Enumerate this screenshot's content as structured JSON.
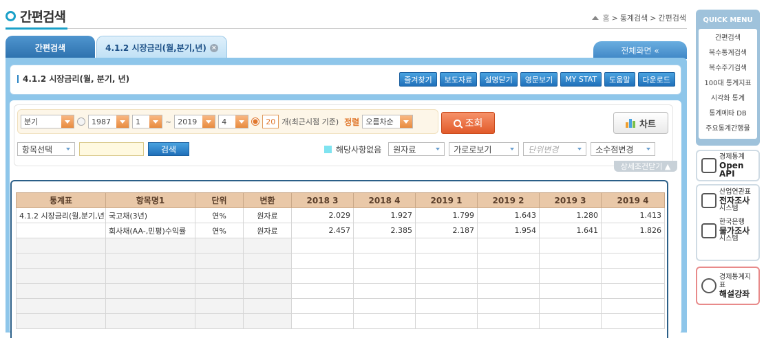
{
  "header": {
    "title": "간편검색",
    "breadcrumb": [
      "홈",
      "통계검색",
      "간편검색"
    ]
  },
  "tabs": [
    {
      "label": "간편검색",
      "active": false
    },
    {
      "label": "4.1.2 시장금리(월,분기,년)",
      "active": true,
      "closable": true
    }
  ],
  "fullscreen_label": "전체화면 «",
  "subheader": {
    "title": "4.1.2 시장금리(월, 분기, 년)",
    "buttons": [
      "즐겨찾기",
      "보도자료",
      "설명닫기",
      "영문보기",
      "MY STAT",
      "도움말",
      "다운로드"
    ]
  },
  "search": {
    "period": "분기",
    "from_year": "1987",
    "from_q": "1",
    "tilde": "~",
    "to_year": "2019",
    "to_q": "4",
    "recent_count": "20",
    "count_label": "개(최근시점 기준)",
    "sort_label": "정렬",
    "sort_value": "오름차순",
    "query_label": "조회",
    "chart_label": "차트",
    "item_select": "항목선택",
    "search_label": "검색",
    "legend": "해당사항없음",
    "data_type": "원자료",
    "view_mode": "가로로보기",
    "unit_change": "단위변경",
    "decimal_change": "소수점변경",
    "collapse_label": "상세조건닫기 ▲"
  },
  "table": {
    "headers": [
      "통계표",
      "항목명1",
      "단위",
      "변환",
      "2018 3",
      "2018 4",
      "2019 1",
      "2019 2",
      "2019 3",
      "2019 4"
    ],
    "rows": [
      {
        "stat": "4.1.2 시장금리(월,분기,년)",
        "item": "국고채(3년)",
        "unit": "연%",
        "conv": "원자료",
        "values": [
          "2.029",
          "1.927",
          "1.799",
          "1.643",
          "1.280",
          "1.413"
        ]
      },
      {
        "stat": "",
        "item": "회사채(AA-,민평)수익률",
        "unit": "연%",
        "conv": "원자료",
        "values": [
          "2.457",
          "2.385",
          "2.187",
          "1.954",
          "1.641",
          "1.826"
        ]
      }
    ]
  },
  "sidebar": {
    "quick_menu_title": "QUICK MENU",
    "quick_menu": [
      "간편검색",
      "복수통계검색",
      "복수주기검색",
      "100대 통계지표",
      "시각화 통계",
      "통계메타 DB",
      "주요통계간행물"
    ],
    "open_api": {
      "small": "경제통계",
      "big": "Open API"
    },
    "survey": {
      "small": "산업연관표",
      "big": "전자조사",
      "tail": "시스템"
    },
    "price": {
      "small": "한국은행",
      "big": "물가조사",
      "tail": "시스템"
    },
    "lecture": {
      "small": "경제통계지표",
      "big": "해설강좌"
    }
  },
  "colors": {
    "accent": "#1aa0c8",
    "tab_blue": "#2c70ad",
    "query_orange": "#e15a2a",
    "header_tan": "#e9c8a8"
  }
}
